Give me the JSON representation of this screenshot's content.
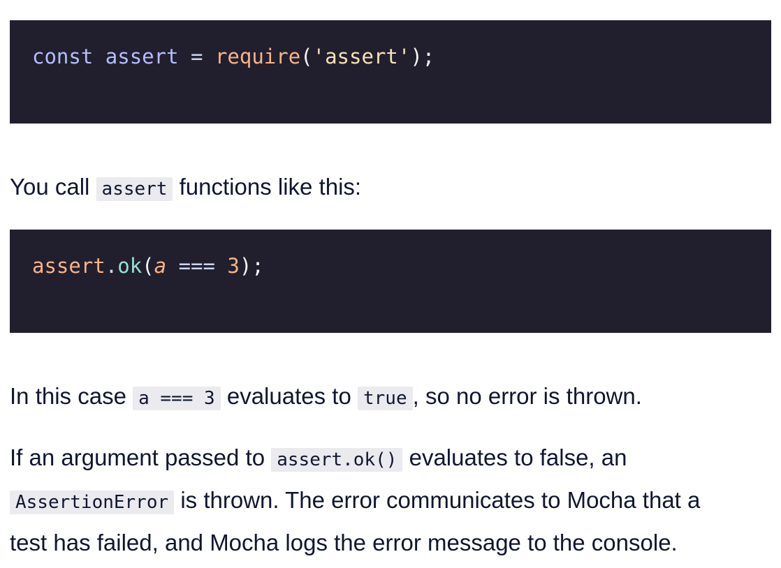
{
  "code_block_1": {
    "tokens": {
      "kw": "const",
      "var": "assert",
      "op": "=",
      "fn": "require",
      "lparen": "(",
      "str": "'assert'",
      "rparen_semi": ");"
    }
  },
  "paragraph_1": {
    "before": "You call",
    "code": "assert",
    "after": "functions like this:"
  },
  "code_block_2": {
    "tokens": {
      "obj": "assert",
      "dot": ".",
      "method": "ok",
      "lparen": "(",
      "id": "a",
      "op": "===",
      "num": "3",
      "rparen_semi": ");"
    }
  },
  "paragraph_2": {
    "before": "In this case",
    "code1": "a === 3",
    "mid": "evaluates to",
    "code2": "true",
    "after": ", so no error is thrown."
  },
  "paragraph_3": {
    "before": "If an argument passed to",
    "code1": "assert.ok()",
    "mid": "evaluates to false, an",
    "code2": "AssertionError",
    "after_line2": "is thrown. The error communicates to Mocha that a",
    "line3": "test has failed, and Mocha logs the error message to the console."
  },
  "colors": {
    "code_background": "#211f2e",
    "inline_code_background": "#eaeaef",
    "text": "#10162f"
  }
}
